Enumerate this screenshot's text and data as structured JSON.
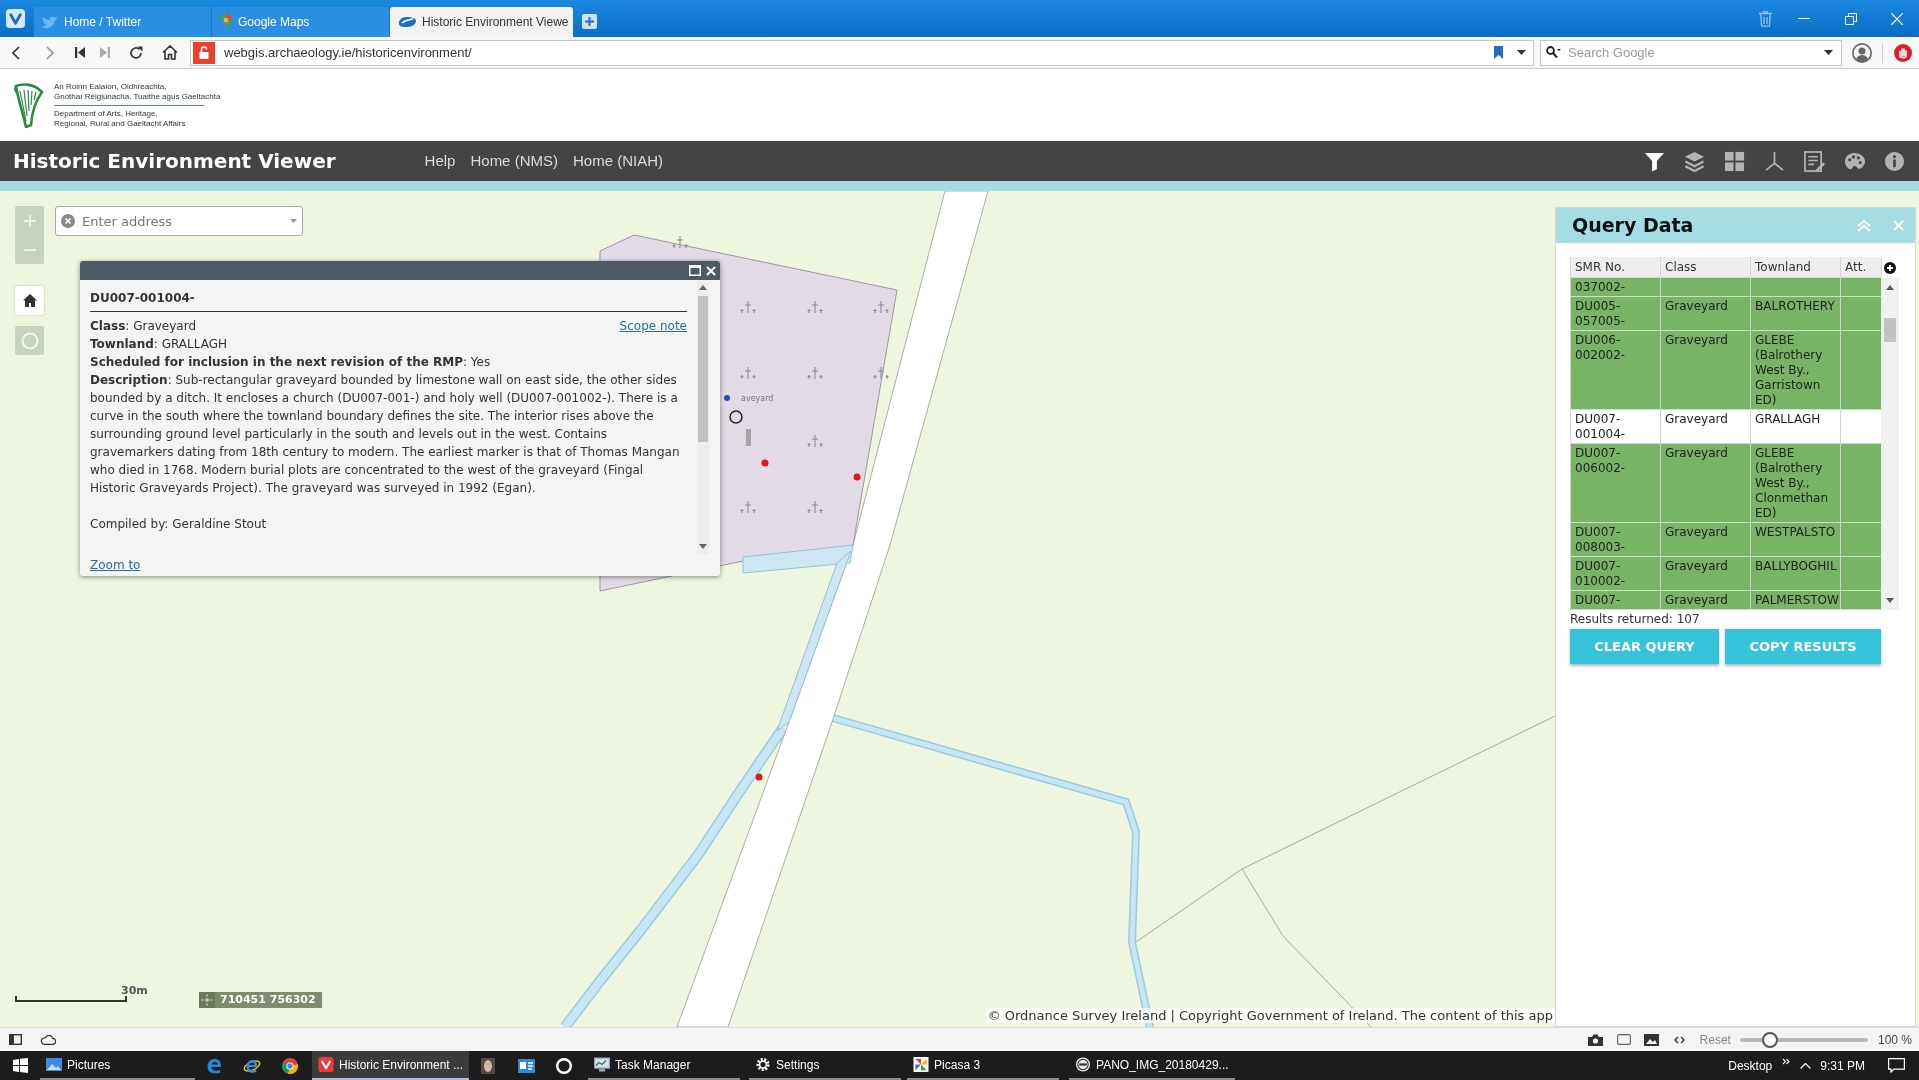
{
  "browser": {
    "tabs": [
      {
        "label": "Home / Twitter",
        "selected": false
      },
      {
        "label": "Google Maps",
        "selected": false
      },
      {
        "label": "Historic Environment Viewe",
        "selected": true
      }
    ],
    "address": "webgis.archaeology.ie/historicenvironment/",
    "search": {
      "placeholder": "Search Google"
    }
  },
  "agency": {
    "irish": [
      "An Roinn Ealaíon, Oidhreachta,",
      "Gnóthaí Réigiúnacha, Tuaithe agus Gaeltachta"
    ],
    "english": [
      "Department of Arts, Heritage,",
      "Regional, Rural and Gaeltacht Affairs"
    ]
  },
  "app_bar": {
    "title": "Historic Environment Viewer",
    "links": [
      "Help",
      "Home (NMS)",
      "Home (NIAH)"
    ],
    "tools": [
      {
        "selected": true
      },
      {
        "selected": false
      },
      {
        "selected": false
      },
      {
        "selected": false
      },
      {
        "selected": false
      },
      {
        "selected": false
      },
      {
        "selected": false
      }
    ]
  },
  "map": {
    "address_search": {
      "placeholder": "Enter address"
    },
    "place_label": "aveyard",
    "scale": "30m",
    "coordinates": "710451 756302",
    "attribution": "© Ordnance Survey Ireland | Copyright Government of Ireland. The content of this app"
  },
  "popup": {
    "title": "DU007-001004-",
    "scope_link": "Scope note",
    "fields": [
      "**Class**: Graveyard",
      "**Townland**: GRALLAGH",
      "**Scheduled for inclusion in the next revision of the RMP**: Yes",
      "**Description**: Sub-rectangular graveyard bounded by limestone wall on east side, the other sides bounded by a ditch. It encloses a church (DU007-001-) and holy well (DU007-001002-). There is a curve in the south where the townland boundary defines the site. The interior rises above the surrounding ground level particularly in the south and levels out in the west. Contains gravemarkers dating from 18th century to modern. The earliest marker is that of Thomas Mangan who died in 1768. Modern burial plots are concentrated to the west of the graveyard (Fingal Historic Graveyards Project). The graveyard was surveyed in 1992 (Egan)."
    ],
    "compiled_by": "Compiled by: Geraldine Stout",
    "zoom_link": "Zoom to"
  },
  "query_panel": {
    "title": "Query Data",
    "columns": [
      "SMR No.",
      "Class",
      "Townland",
      "Att."
    ],
    "rows": [
      {
        "cells": [
          "037002-"
        ],
        "selected": false
      },
      {
        "cells": [
          "DU005-057005-",
          "Graveyard",
          "BALROTHERY"
        ],
        "selected": false
      },
      {
        "cells": [
          "DU006-002002-",
          "Graveyard",
          "GLEBE (Balrothery West By., Garristown ED)"
        ],
        "selected": false
      },
      {
        "cells": [
          "DU007-001004-",
          "Graveyard",
          "GRALLAGH"
        ],
        "selected": true
      },
      {
        "cells": [
          "DU007-006002-",
          "Graveyard",
          "GLEBE (Balrothery West By., Clonmethan ED)"
        ],
        "selected": false
      },
      {
        "cells": [
          "DU007-008003-",
          "Graveyard",
          "WESTPALSTO"
        ],
        "selected": false
      },
      {
        "cells": [
          "DU007-010002-",
          "Graveyard",
          "BALLYBOGHIL"
        ],
        "selected": false
      },
      {
        "cells": [
          "DU007-",
          "Graveyard",
          "PALMERSTOW"
        ],
        "selected": false
      }
    ],
    "results": "Results returned: 107",
    "buttons": [
      "CLEAR QUERY",
      "COPY RESULTS"
    ]
  },
  "status_bar": {
    "reset": "Reset",
    "zoom": {
      "level": 0.2,
      "reading": "100 %"
    }
  },
  "taskbar": {
    "apps": [
      {
        "label": "Pictures",
        "selected": false
      },
      {
        "label": "Historic Environment ...",
        "selected": true
      },
      {
        "label": "Task Manager",
        "selected": false
      },
      {
        "label": "Settings",
        "selected": false
      },
      {
        "label": "Picasa 3",
        "selected": false
      },
      {
        "label": "PANO_IMG_20180429...",
        "selected": false
      }
    ],
    "desktop": "Desktop",
    "clock": "9:31 PM"
  }
}
